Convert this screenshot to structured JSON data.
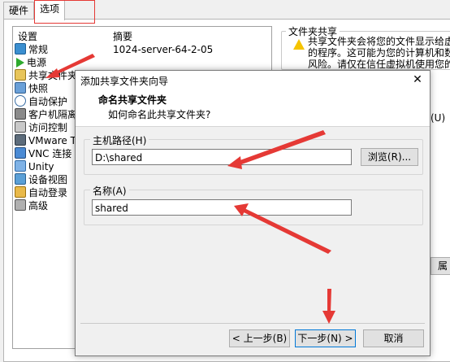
{
  "tabs": [
    {
      "label": "硬件"
    },
    {
      "label": "选项"
    }
  ],
  "settings": {
    "header_setting": "设置",
    "header_summary": "摘要",
    "items": [
      {
        "label": "常规",
        "summary": "1024-server-64-2-05",
        "icon": "monitor-icon"
      },
      {
        "label": "电源",
        "summary": "",
        "icon": "play-icon"
      },
      {
        "label": "共享文件夹",
        "summary": "",
        "icon": "shared-folder-icon"
      },
      {
        "label": "快照",
        "summary": "",
        "icon": "snapshot-icon"
      },
      {
        "label": "自动保护",
        "summary": "",
        "icon": "clock-icon"
      },
      {
        "label": "客户机隔离",
        "summary": "",
        "icon": "isolation-icon"
      },
      {
        "label": "访问控制",
        "summary": "",
        "icon": "access-icon"
      },
      {
        "label": "VMware Too",
        "summary": "",
        "icon": "vmware-icon"
      },
      {
        "label": "VNC 连接",
        "summary": "",
        "icon": "vnc-icon"
      },
      {
        "label": "Unity",
        "summary": "",
        "icon": "unity-icon"
      },
      {
        "label": "设备视图",
        "summary": "",
        "icon": "device-view-icon"
      },
      {
        "label": "自动登录",
        "summary": "",
        "icon": "autologin-icon"
      },
      {
        "label": "高级",
        "summary": "",
        "icon": "advanced-icon"
      }
    ]
  },
  "right_panel": {
    "group_title": "文件夹共享",
    "warning_lines": [
      "共享文件夹会将您的文件显示给虚拟机",
      "的程序。这可能为您的计算机和数据",
      "风险。请仅在信任虚拟机使用您的数"
    ],
    "partial_u": "(U)",
    "partial_btn": "属"
  },
  "dialog": {
    "title": "添加共享文件夹向导",
    "heading": "命名共享文件夹",
    "subheading": "如何命名此共享文件夹?",
    "host_path_label": "主机路径(H)",
    "host_path_value": "D:\\shared",
    "browse_label": "浏览(R)...",
    "name_label": "名称(A)",
    "name_value": "shared",
    "back_label": "< 上一步(B)",
    "next_label": "下一步(N) >",
    "cancel_label": "取消",
    "close_glyph": "✕"
  },
  "colors": {
    "annotation_red": "#e53935",
    "warning_yellow": "#f5c400",
    "accent_blue": "#0078d7"
  }
}
